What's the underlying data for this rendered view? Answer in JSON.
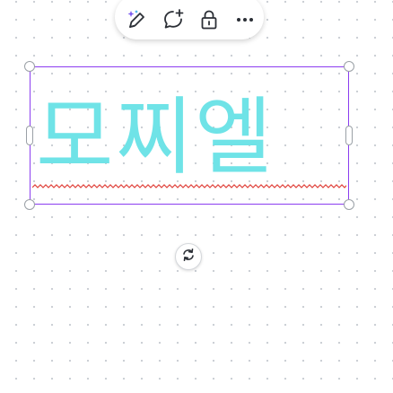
{
  "toolbar": {
    "items": [
      {
        "icon": "magic-edit-icon"
      },
      {
        "icon": "comment-add-icon"
      },
      {
        "icon": "lock-icon"
      },
      {
        "icon": "more-icon"
      }
    ]
  },
  "canvas": {
    "text_element": {
      "text": "모찌엘",
      "color": "#6fe3e7",
      "spellcheck_underline_color": "#e0413a"
    },
    "selection_color": "#8b3df0",
    "rotate_handle": {
      "icon": "rotate-icon"
    }
  }
}
